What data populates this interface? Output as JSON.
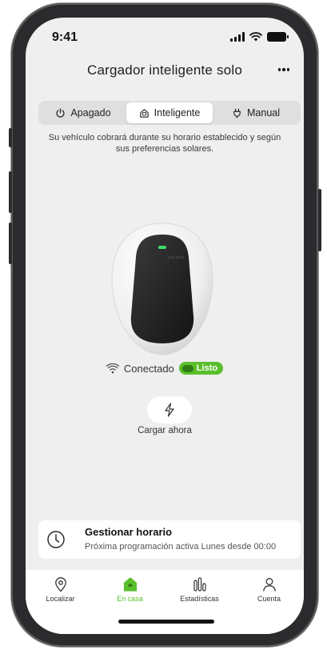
{
  "status_bar": {
    "time": "9:41"
  },
  "header": {
    "title": "Cargador inteligente solo",
    "more_icon": "more-icon"
  },
  "mode_switch": {
    "selected": "Inteligente",
    "options": [
      {
        "label": "Apagado",
        "icon": "power-icon"
      },
      {
        "label": "Inteligente",
        "icon": "smart-charger-icon"
      },
      {
        "label": "Manual",
        "icon": "plug-icon"
      }
    ]
  },
  "mode_description": "Su vehículo cobrará durante su horario establecido y según sus preferencias solares.",
  "charger": {
    "brand_text": "pod.point"
  },
  "connection": {
    "status": "Conectado",
    "badge": "Listo",
    "badge_color": "#5abf2c"
  },
  "charge_now": {
    "label": "Cargar ahora"
  },
  "schedule": {
    "title": "Gestionar horario",
    "subtitle": "Próxima programación activa Lunes desde 00:00"
  },
  "bottom_nav": {
    "active": "En casa",
    "items": [
      {
        "label": "Localizar",
        "icon": "location-pin-icon"
      },
      {
        "label": "En casa",
        "icon": "home-icon"
      },
      {
        "label": "Estadísticas",
        "icon": "stats-icon"
      },
      {
        "label": "Cuenta",
        "icon": "account-icon"
      }
    ]
  },
  "colors": {
    "accent": "#5abf2c",
    "background": "#efefef"
  }
}
